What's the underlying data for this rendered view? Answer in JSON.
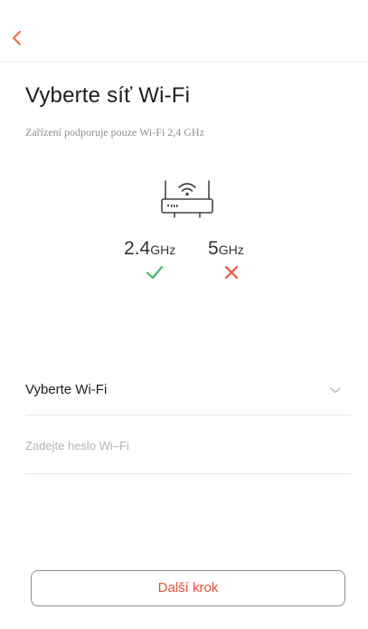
{
  "header": {
    "back_icon": "chevron-left-icon",
    "accent_color": "#ff6a3d"
  },
  "title": "Vyberte síť Wi-Fi",
  "subtitle": "Zařízení podporuje pouze Wi-Fi 2,4 GHz",
  "bands": [
    {
      "value": "2.4",
      "unit": "GHz",
      "supported": true,
      "status_icon": "checkmark-icon",
      "status_color": "#3cc16b"
    },
    {
      "value": "5",
      "unit": "GHz",
      "supported": false,
      "status_icon": "cross-icon",
      "status_color": "#f0563c"
    }
  ],
  "form": {
    "wifi_select_label": "Vyberte Wi-Fi",
    "wifi_select_icon": "chevron-down-icon",
    "password_placeholder": "Zadejte heslo Wi–Fi",
    "password_value": ""
  },
  "next_button_label": "Další krok"
}
